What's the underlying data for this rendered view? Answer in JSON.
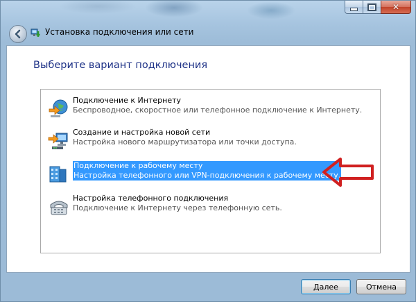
{
  "window": {
    "title": "Установка подключения или сети",
    "controls": {
      "minimize": "minimize",
      "maximize": "maximize",
      "close": "✕"
    }
  },
  "heading": "Выберите вариант подключения",
  "options": [
    {
      "title": "Подключение к Интернету",
      "description": "Беспроводное, скоростное или телефонное подключение к Интернету.",
      "icon": "internet-globe-icon",
      "selected": false
    },
    {
      "title": "Создание и настройка новой сети",
      "description": "Настройка нового маршрутизатора или точки доступа.",
      "icon": "new-network-icon",
      "selected": false
    },
    {
      "title": "Подключение к рабочему месту",
      "description": "Настройка телефонного или VPN-подключения к рабочему месту.",
      "icon": "workplace-icon",
      "selected": true
    },
    {
      "title": "Настройка телефонного подключения",
      "description": "Подключение к Интернету через телефонную сеть.",
      "icon": "dialup-modem-icon",
      "selected": false
    }
  ],
  "buttons": {
    "next": "Далее",
    "cancel": "Отмена"
  },
  "colors": {
    "heading": "#1e3287",
    "selection": "#3399ff",
    "annotation_arrow": "#d02020"
  }
}
